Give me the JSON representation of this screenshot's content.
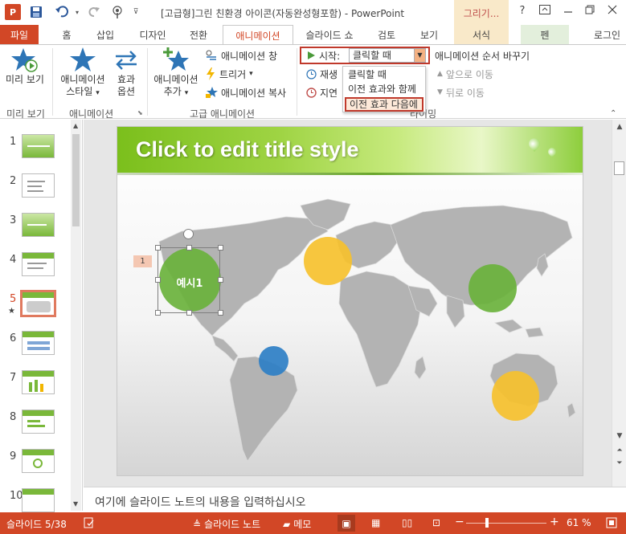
{
  "titlebar": {
    "app_logo": "P",
    "doc_title": "[고급형]그린 친환경 아이콘(자동완성형포함) - PowerPoint",
    "context_group": "그리기...",
    "help": "?",
    "icons": [
      "save-icon",
      "undo-icon",
      "redo-icon",
      "touch-mode-icon",
      "customize-icon"
    ]
  },
  "tabs": [
    "파일",
    "홈",
    "삽입",
    "디자인",
    "전환",
    "애니메이션",
    "슬라이드 쇼",
    "검토",
    "보기",
    "서식",
    "펜",
    "로그인"
  ],
  "ribbon": {
    "preview": {
      "label": "미리 보기",
      "group": "미리 보기"
    },
    "animation_style": {
      "label1": "애니메이션",
      "label2": "스타일",
      "dropdown": "▾"
    },
    "effect_options": {
      "label1": "효과",
      "label2": "옵션"
    },
    "animation_group": "애니메이션",
    "add_animation": {
      "label1": "애니메이션",
      "label2": "추가"
    },
    "animation_pane": "애니메이션 창",
    "trigger": "트리거",
    "animation_painter": "애니메이션 복사",
    "advanced_group": "고급 애니메이션",
    "start_label": "시작:",
    "start_value": "클릭할 때",
    "duration_label": "재생",
    "delay_label": "지연",
    "reorder_label": "애니메이션 순서 바꾸기",
    "move_earlier": "앞으로 이동",
    "move_later": "뒤로 이동",
    "timing_group": "타이밍"
  },
  "dropdown": {
    "items": [
      "클릭할 때",
      "이전 효과와 함께",
      "이전 효과 다음에"
    ],
    "selected_index": 2
  },
  "thumbnails": {
    "numbers": [
      "1",
      "2",
      "3",
      "4",
      "5",
      "6",
      "7",
      "8",
      "9",
      "10"
    ],
    "selected": "5"
  },
  "slide": {
    "title": "Click to edit title style",
    "animation_tag": "1",
    "bubble_label": "예시1",
    "bubble_colors": {
      "green": "#6ab23c",
      "yellow": "#f6c12e",
      "blue": "#2e7fc6"
    }
  },
  "notes": {
    "placeholder": "여기에 슬라이드 노트의 내용을 입력하십시오"
  },
  "status": {
    "slide_info": "슬라이드 5/38",
    "notes_btn": "슬라이드 노트",
    "comments_btn": "메모",
    "zoom_out": "−",
    "zoom_in": "+",
    "zoom": "61 %"
  },
  "colors": {
    "accent": "#d24726",
    "highlight": "#c0392b"
  }
}
